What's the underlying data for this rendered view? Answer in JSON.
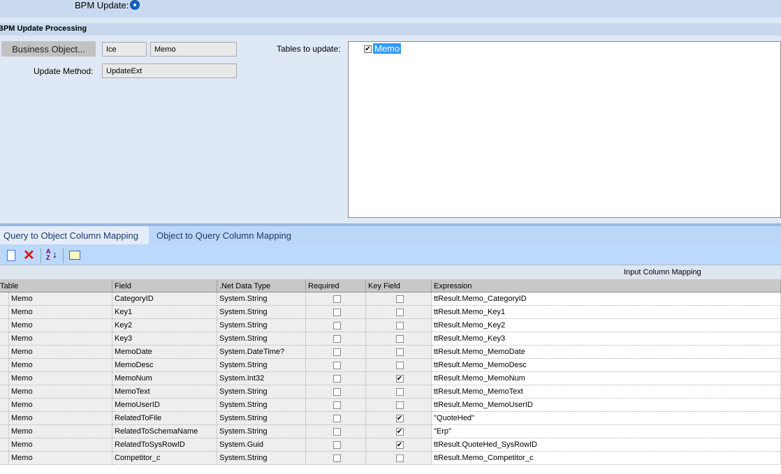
{
  "top": {
    "bpm_update_label": "BPM Update:",
    "bpm_update_selected": true
  },
  "section": {
    "title": "BPM Update Processing"
  },
  "form": {
    "business_object_button": "Business Object...",
    "bo_system": "Ice",
    "bo_name": "Memo",
    "update_method_label": "Update Method:",
    "update_method_value": "UpdateExt",
    "tables_label": "Tables to update:",
    "tables": [
      {
        "name": "Memo",
        "checked": true
      }
    ]
  },
  "tabs": [
    {
      "label": "Query to Object Column Mapping",
      "active": true
    },
    {
      "label": "Object to Query Column Mapping",
      "active": false
    }
  ],
  "toolbar": {
    "icons": [
      "new-icon",
      "delete-icon",
      "sort-az-icon",
      "edit-grid-icon"
    ]
  },
  "grid": {
    "group_label": "Input Column Mapping",
    "columns": [
      "Table",
      "Field",
      ".Net Data Type",
      "Required",
      "Key Field",
      "Expression"
    ],
    "rows": [
      {
        "table": "Memo",
        "field": "CategoryID",
        "type": "System.String",
        "required": false,
        "key": false,
        "expr": "ttResult.Memo_CategoryID"
      },
      {
        "table": "Memo",
        "field": "Key1",
        "type": "System.String",
        "required": false,
        "key": false,
        "expr": "ttResult.Memo_Key1"
      },
      {
        "table": "Memo",
        "field": "Key2",
        "type": "System.String",
        "required": false,
        "key": false,
        "expr": "ttResult.Memo_Key2"
      },
      {
        "table": "Memo",
        "field": "Key3",
        "type": "System.String",
        "required": false,
        "key": false,
        "expr": "ttResult.Memo_Key3"
      },
      {
        "table": "Memo",
        "field": "MemoDate",
        "type": "System.DateTime?",
        "required": false,
        "key": false,
        "expr": "ttResult.Memo_MemoDate"
      },
      {
        "table": "Memo",
        "field": "MemoDesc",
        "type": "System.String",
        "required": false,
        "key": false,
        "expr": "ttResult.Memo_MemoDesc"
      },
      {
        "table": "Memo",
        "field": "MemoNum",
        "type": "System.Int32",
        "required": false,
        "key": true,
        "expr": "ttResult.Memo_MemoNum"
      },
      {
        "table": "Memo",
        "field": "MemoText",
        "type": "System.String",
        "required": false,
        "key": false,
        "expr": "ttResult.Memo_MemoText"
      },
      {
        "table": "Memo",
        "field": "MemoUserID",
        "type": "System.String",
        "required": false,
        "key": false,
        "expr": "ttResult.Memo_MemoUserID"
      },
      {
        "table": "Memo",
        "field": "RelatedToFile",
        "type": "System.String",
        "required": false,
        "key": true,
        "expr": "\"QuoteHed\""
      },
      {
        "table": "Memo",
        "field": "RelatedToSchemaName",
        "type": "System.String",
        "required": false,
        "key": true,
        "expr": "\"Erp\""
      },
      {
        "table": "Memo",
        "field": "RelatedToSysRowID",
        "type": "System.Guid",
        "required": false,
        "key": true,
        "expr": "ttResult.QuoteHed_SysRowID"
      },
      {
        "table": "Memo",
        "field": "Competitor_c",
        "type": "System.String",
        "required": false,
        "key": false,
        "expr": "ttResult.Memo_Competitor_c"
      }
    ]
  }
}
